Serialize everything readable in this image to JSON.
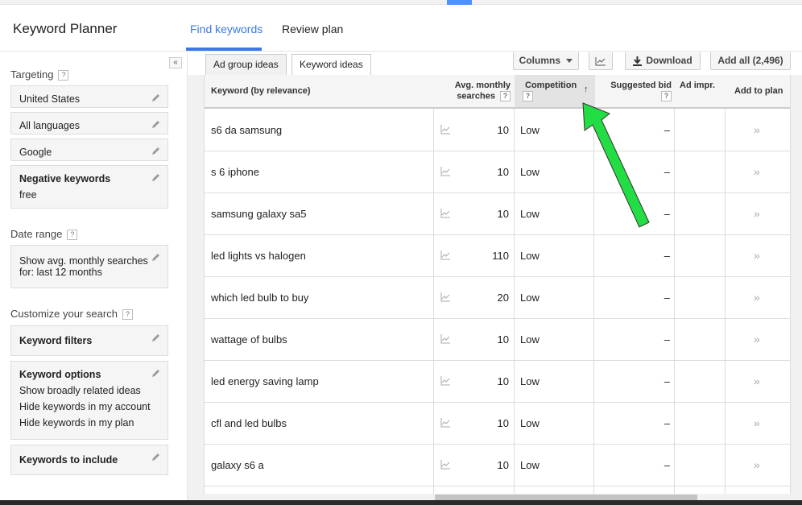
{
  "app": {
    "title": "Keyword Planner"
  },
  "nav": {
    "find_keywords": "Find keywords",
    "review_plan": "Review plan"
  },
  "sidebar": {
    "collapse_glyph": "«",
    "targeting_label": "Targeting",
    "help_glyph": "?",
    "location": "United States",
    "language": "All languages",
    "network": "Google",
    "negative_title": "Negative keywords",
    "negative_value": "free",
    "date_range_label": "Date range",
    "date_range_line1": "Show avg. monthly searches",
    "date_range_line2": "for: last 12 months",
    "customize_label": "Customize your search",
    "keyword_filters": "Keyword filters",
    "keyword_options_title": "Keyword options",
    "keyword_options_lines": [
      "Show broadly related ideas",
      "Hide keywords in my account",
      "Hide keywords in my plan"
    ],
    "keywords_to_include": "Keywords to include"
  },
  "toolbar": {
    "tab_ad_group": "Ad group ideas",
    "tab_keyword_ideas": "Keyword ideas",
    "columns": "Columns",
    "download": "Download",
    "add_all": "Add all (2,496)"
  },
  "table": {
    "headers": {
      "keyword": "Keyword (by relevance)",
      "avg_line1": "Avg. monthly",
      "avg_line2": "searches",
      "competition": "Competition",
      "suggested_bid": "Suggested bid",
      "ad_impr": "Ad impr.",
      "add_to_plan": "Add to plan"
    },
    "rows": [
      {
        "keyword": "s6 da samsung",
        "searches": "10",
        "competition": "Low",
        "bid": "–"
      },
      {
        "keyword": "s 6 iphone",
        "searches": "10",
        "competition": "Low",
        "bid": "–"
      },
      {
        "keyword": "samsung galaxy sa5",
        "searches": "10",
        "competition": "Low",
        "bid": "–"
      },
      {
        "keyword": "led lights vs halogen",
        "searches": "110",
        "competition": "Low",
        "bid": "–"
      },
      {
        "keyword": "which led bulb to buy",
        "searches": "20",
        "competition": "Low",
        "bid": "–"
      },
      {
        "keyword": "wattage of bulbs",
        "searches": "10",
        "competition": "Low",
        "bid": "–"
      },
      {
        "keyword": "led energy saving lamp",
        "searches": "10",
        "competition": "Low",
        "bid": "–"
      },
      {
        "keyword": "cfl and led bulbs",
        "searches": "10",
        "competition": "Low",
        "bid": "–"
      },
      {
        "keyword": "galaxy s6 a",
        "searches": "10",
        "competition": "Low",
        "bid": "–"
      }
    ],
    "add_glyph": "»",
    "sort_glyph": "↑"
  },
  "colors": {
    "accent": "#3b78e7",
    "annotation_arrow": "#22dd44"
  }
}
